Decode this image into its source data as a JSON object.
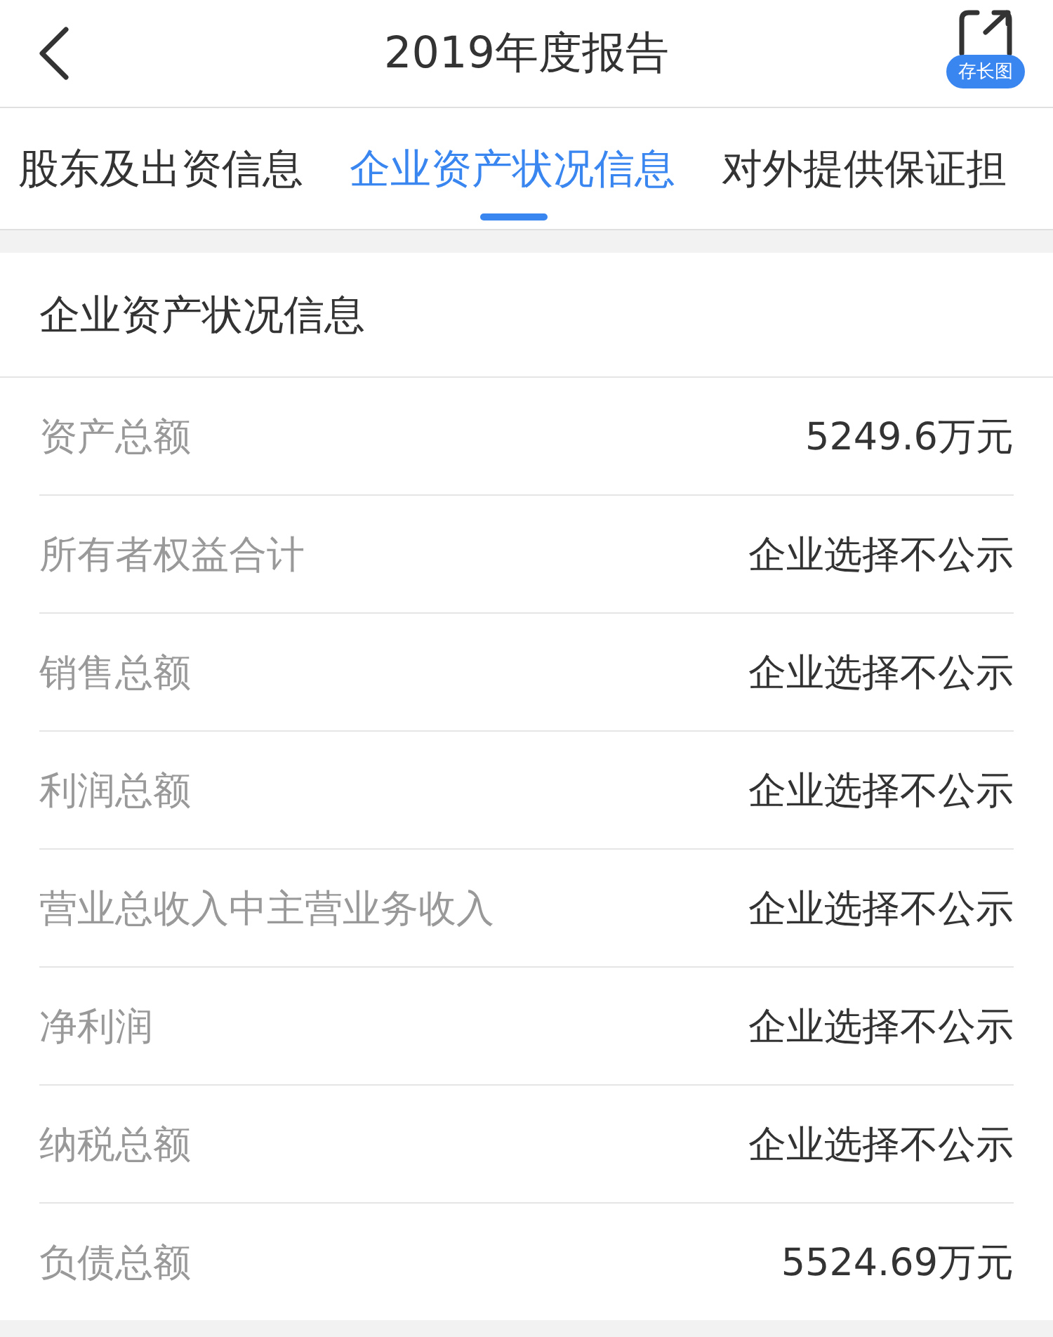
{
  "header": {
    "title": "2019年度报告",
    "badge": "存长图"
  },
  "tabs": [
    {
      "label": "股东及出资信息",
      "selected": false
    },
    {
      "label": "企业资产状况信息",
      "selected": true
    },
    {
      "label": "对外提供保证担",
      "selected": false
    }
  ],
  "section": {
    "title": "企业资产状况信息",
    "rows": [
      {
        "label": "资产总额",
        "value": "5249.6万元"
      },
      {
        "label": "所有者权益合计",
        "value": "企业选择不公示"
      },
      {
        "label": "销售总额",
        "value": "企业选择不公示"
      },
      {
        "label": "利润总额",
        "value": "企业选择不公示"
      },
      {
        "label": "营业总收入中主营业务收入",
        "value": "企业选择不公示"
      },
      {
        "label": "净利润",
        "value": "企业选择不公示"
      },
      {
        "label": "纳税总额",
        "value": "企业选择不公示"
      },
      {
        "label": "负债总额",
        "value": "5524.69万元"
      }
    ]
  }
}
